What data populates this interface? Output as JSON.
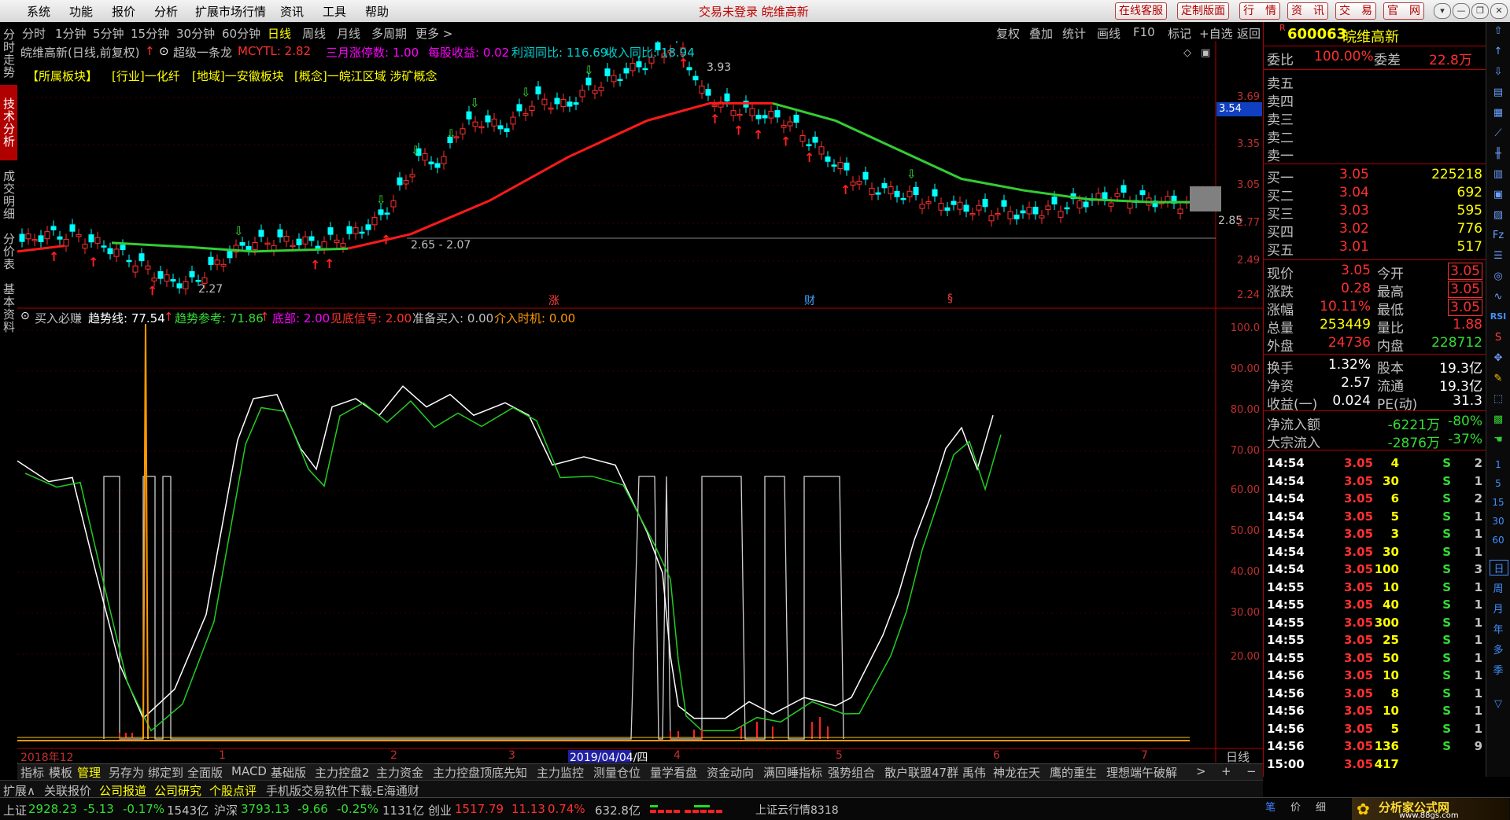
{
  "menu": {
    "items": [
      "系统",
      "功能",
      "报价",
      "分析",
      "扩展市场行情",
      "资讯",
      "工具",
      "帮助"
    ],
    "notice": "交易未登录 皖维高新",
    "right_buttons": [
      "在线客服",
      "定制版面",
      "行　情",
      "资　讯",
      "交　易",
      "官　网"
    ],
    "window_buttons": [
      "▾",
      "—",
      "❐",
      "✕"
    ]
  },
  "left_tabs": [
    "分时走势",
    "技术分析",
    "成交明细",
    "分价表",
    "基本资料"
  ],
  "period_tabs": [
    "分时",
    "1分钟",
    "5分钟",
    "15分钟",
    "30分钟",
    "60分钟",
    "日线",
    "周线",
    "月线",
    "多周期",
    "更多 >"
  ],
  "right_tools": [
    "复权",
    "叠加",
    "统计",
    "画线",
    "F10",
    "标记",
    "+自选",
    "返回"
  ],
  "main": {
    "title": "皖维高新(日线,前复权)",
    "indicator": "超级一条龙",
    "mcytl": "MCYTL: 2.82",
    "s1": "三月涨停数: 1.00",
    "s2": "每股收益: 0.02",
    "s3": "利润同比: 116.69",
    "s4": "收入同比: 18.94",
    "boards": [
      "【所属板块】",
      "[行业]一化纤",
      "[地域]一安徽板块",
      "[概念]一皖江区域 涉矿概念"
    ],
    "axis": [
      "3.69",
      "3.35",
      "3.05",
      "2.77",
      "2.49",
      "2.24"
    ],
    "cursor_price": "3.54",
    "hi_label": "3.93",
    "range_label": "2.65 - 2.07",
    "low_label": "2.27",
    "last_label": "2.85",
    "markers": [
      "涨",
      "财",
      "§"
    ]
  },
  "sub": {
    "name": "买入必赚",
    "trend": "趋势线: 77.54",
    "ref": "趋势参考: 71.86",
    "bottom": "底部: 2.00",
    "signal": "见底信号: 2.00",
    "prepare": "准备买入: 0.00",
    "timing": "介入时机: 0.00",
    "axis": [
      "100.0",
      "90.00",
      "80.00",
      "70.00",
      "60.00",
      "50.00",
      "40.00",
      "30.00",
      "20.00"
    ]
  },
  "dates": {
    "labels": [
      "2018年12",
      "1",
      "2",
      "3",
      "4",
      "5",
      "6",
      "7"
    ],
    "cursor": "2019/04/04/四",
    "period": "日线"
  },
  "indicators": [
    "指标",
    "模板",
    "管理",
    "另存为",
    "绑定到",
    "全面版",
    "MACD",
    "基础版",
    "主力控盘2",
    "主力资金",
    "主力控盘",
    "顶底先知",
    "主力监控",
    "测量仓位",
    "量学看盘",
    "资金动向",
    "满回睡指标",
    "强势组合",
    "散户联盟47群 禹伟",
    "神龙在天",
    "鹰的重生",
    "理想端午破解"
  ],
  "infobar": [
    "扩展∧",
    "关联报价",
    "公司报道",
    "公司研究",
    "个股点评",
    "手机版交易软件下载-E海通财"
  ],
  "quote": {
    "code": "600063",
    "name": "皖维高新",
    "webi_label": "委比",
    "webi": "100.00%",
    "wecha_label": "委差",
    "wecha": "22.8万",
    "sells": [
      "卖五",
      "卖四",
      "卖三",
      "卖二",
      "卖一"
    ],
    "buys": [
      {
        "label": "买一",
        "price": "3.05",
        "vol": "225218"
      },
      {
        "label": "买二",
        "price": "3.04",
        "vol": "692"
      },
      {
        "label": "买三",
        "price": "3.03",
        "vol": "595"
      },
      {
        "label": "买四",
        "price": "3.02",
        "vol": "776"
      },
      {
        "label": "买五",
        "price": "3.01",
        "vol": "517"
      }
    ],
    "stats": [
      {
        "l1": "现价",
        "v1": "3.05",
        "l2": "今开",
        "v2": "3.05"
      },
      {
        "l1": "涨跌",
        "v1": "0.28",
        "l2": "最高",
        "v2": "3.05"
      },
      {
        "l1": "涨幅",
        "v1": "10.11%",
        "l2": "最低",
        "v2": "3.05"
      },
      {
        "l1": "总量",
        "v1": "253449",
        "l2": "量比",
        "v2": "1.88"
      },
      {
        "l1": "外盘",
        "v1": "24736",
        "l2": "内盘",
        "v2": "228712"
      }
    ],
    "stats2": [
      {
        "l1": "换手",
        "v1": "1.32%",
        "l2": "股本",
        "v2": "19.3亿"
      },
      {
        "l1": "净资",
        "v1": "2.57",
        "l2": "流通",
        "v2": "19.3亿"
      },
      {
        "l1": "收益(一)",
        "v1": "0.024",
        "l2": "PE(动)",
        "v2": "31.3"
      }
    ],
    "flow": [
      {
        "label": "净流入额",
        "v": "-6221万",
        "p": "-80%"
      },
      {
        "label": "大宗流入",
        "v": "-2876万",
        "p": "-37%"
      }
    ],
    "ticks": [
      [
        "14:54",
        "3.05",
        "4",
        "S",
        "2"
      ],
      [
        "14:54",
        "3.05",
        "30",
        "S",
        "1"
      ],
      [
        "14:54",
        "3.05",
        "6",
        "S",
        "2"
      ],
      [
        "14:54",
        "3.05",
        "5",
        "S",
        "1"
      ],
      [
        "14:54",
        "3.05",
        "3",
        "S",
        "1"
      ],
      [
        "14:54",
        "3.05",
        "30",
        "S",
        "1"
      ],
      [
        "14:54",
        "3.05",
        "100",
        "S",
        "3"
      ],
      [
        "14:55",
        "3.05",
        "10",
        "S",
        "1"
      ],
      [
        "14:55",
        "3.05",
        "40",
        "S",
        "1"
      ],
      [
        "14:55",
        "3.05",
        "300",
        "S",
        "1"
      ],
      [
        "14:55",
        "3.05",
        "25",
        "S",
        "1"
      ],
      [
        "14:55",
        "3.05",
        "50",
        "S",
        "1"
      ],
      [
        "14:56",
        "3.05",
        "10",
        "S",
        "1"
      ],
      [
        "14:56",
        "3.05",
        "8",
        "S",
        "1"
      ],
      [
        "14:56",
        "3.05",
        "10",
        "S",
        "1"
      ],
      [
        "14:56",
        "3.05",
        "5",
        "S",
        "1"
      ],
      [
        "14:56",
        "3.05",
        "136",
        "S",
        "9"
      ],
      [
        "15:00",
        "3.05",
        "417",
        "",
        ""
      ]
    ],
    "tabs": [
      "笔",
      "价",
      "细"
    ]
  },
  "icon_strip": [
    "RSI",
    "S",
    "日",
    "周",
    "月",
    "年",
    "多",
    "季",
    "1",
    "5",
    "15",
    "30",
    "60"
  ],
  "status": {
    "sh": "上证",
    "sh_v": "2928.23",
    "sh_c": "-5.13",
    "sh_p": "-0.17%",
    "sh_a": "1543亿",
    "hs": "沪深",
    "hs_v": "3793.13",
    "hs_c": "-9.66",
    "hs_p": "-0.25%",
    "hs_a": "1131亿",
    "cy": "创业",
    "cy_v": "1517.79",
    "cy_c": "11.13",
    "cy_p": "0.74%",
    "cy_a": "632.8亿",
    "cloud": "上证云行情8318",
    "logo": "分析家公式网",
    "logo_url": "www.88gs.com"
  }
}
